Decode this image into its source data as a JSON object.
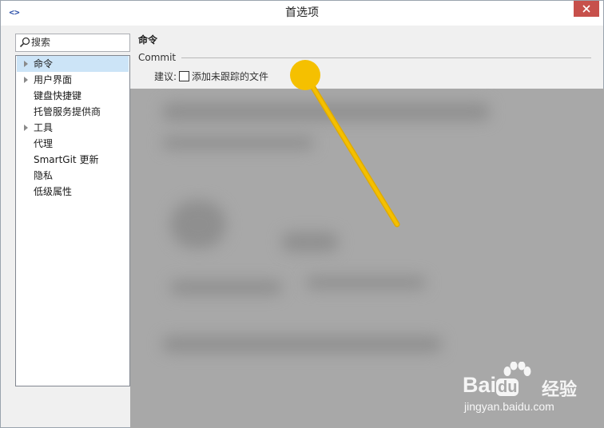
{
  "window": {
    "title": "首选项",
    "app_icon_glyph": "<>"
  },
  "sidebar": {
    "search_label": "搜索",
    "items": [
      {
        "label": "命令",
        "expandable": true,
        "selected": true
      },
      {
        "label": "用户界面",
        "expandable": true,
        "selected": false
      },
      {
        "label": "键盘快捷键",
        "expandable": false,
        "selected": false
      },
      {
        "label": "托管服务提供商",
        "expandable": false,
        "selected": false
      },
      {
        "label": "工具",
        "expandable": true,
        "selected": false
      },
      {
        "label": "代理",
        "expandable": false,
        "selected": false
      },
      {
        "label": "SmartGit 更新",
        "expandable": false,
        "selected": false
      },
      {
        "label": "隐私",
        "expandable": false,
        "selected": false
      },
      {
        "label": "低级属性",
        "expandable": false,
        "selected": false
      }
    ]
  },
  "main": {
    "panel_title": "命令",
    "group_label": "Commit",
    "suggest_label": "建议:",
    "checkbox_label": "添加未跟踪的文件",
    "checkbox_checked": false
  },
  "watermark": {
    "brand": "Bai",
    "brand_suffix": "du",
    "cn_text": "经验",
    "url": "jingyan.baidu.com"
  },
  "colors": {
    "selection": "#cce4f7",
    "close_button": "#c7504b",
    "pointer": "#f5c000",
    "overlay": "#a8a8a8"
  },
  "icons": {
    "app": "code-brackets-icon",
    "search": "search-icon",
    "close": "close-icon",
    "tree_expand": "triangle-right-icon",
    "pointer": "pointer-dot-icon"
  }
}
